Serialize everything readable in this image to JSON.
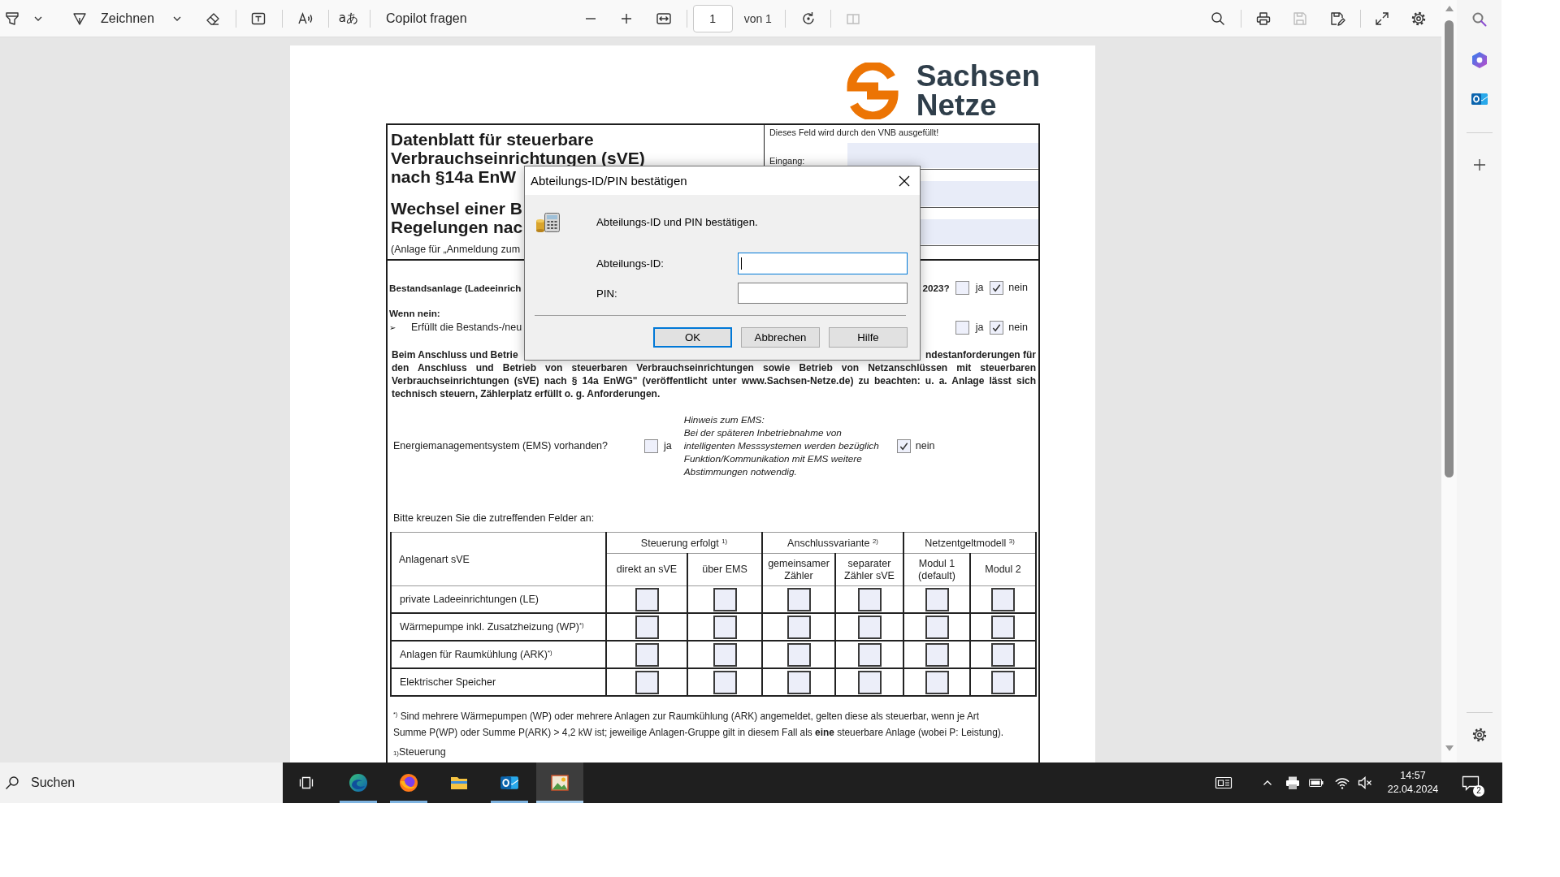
{
  "toolbar": {
    "draw_label": "Zeichnen",
    "translate_label": "aあ",
    "copilot_label": "Copilot fragen",
    "page_number": "1",
    "page_total": "von 1",
    "two_page_disabled": true,
    "save_disabled": true
  },
  "document": {
    "logo": {
      "line_1": "Sachsen",
      "line_2": "Netze"
    },
    "title_lines": [
      "Datenblatt für steuerbare",
      "Verbrauchseinrichtungen (sVE)",
      "nach §14a EnW"
    ],
    "subtitle_lines": [
      "Wechsel einer B",
      "Regelungen nac"
    ],
    "annex_note": "(Anlage für „Anmeldung zum",
    "office_note": "Dieses Feld wird durch den VNB ausgefüllt!",
    "office_field_label": "Eingang:",
    "existing_question": {
      "text": "Bestandsanlage (Ladeeinrich",
      "tail": "2023?",
      "options": [
        {
          "label": "ja",
          "checked": false
        },
        {
          "label": "nein",
          "checked": true
        }
      ]
    },
    "if_no": {
      "heading": "Wenn nein:",
      "bullet": "➢",
      "text": "Erfüllt die Bestands-/neu",
      "options": [
        {
          "label": "ja",
          "checked": false
        },
        {
          "label": "nein",
          "checked": true
        }
      ]
    },
    "notice": {
      "start": "Beim Anschluss und Betrie",
      "end": "ndestanforderungen für",
      "text": "den Anschluss und Betrieb von steuerbaren Verbrauchseinrichtungen sowie Betrieb von Netzanschlüssen mit steuerbaren Verbrauchseinrichtungen (sVE) nach § 14a EnWG\" (veröffentlicht unter www.Sachsen-Netze.de) zu beachten: u. a. Anlage lässt sich technisch steuern, Zählerplatz erfüllt o. g. Anforderungen."
    },
    "ems": {
      "question": "Energiemanagementsystem (EMS) vorhanden?",
      "options": [
        {
          "label": "ja",
          "checked": false
        },
        {
          "label": "nein",
          "checked": true
        }
      ],
      "hint_title": "Hinweis zum EMS:",
      "hint": "Bei der späteren Inbetriebnahme von intelligenten Messsystemen werden bezüglich Funktion/Kommunikation mit EMS weitere Abstimmungen notwendig."
    },
    "instruction": "Bitte kreuzen Sie die zutreffenden Felder an:",
    "table": {
      "row_header": "Anlagenart sVE",
      "groups": [
        {
          "label": "Steuerung erfolgt $^{1)}$",
          "columns": [
            "direkt an sVE",
            "über EMS"
          ]
        },
        {
          "label": "Anschlussvariante $^{2)}$",
          "columns": [
            "gemeinsamer Zähler",
            "separater Zähler sVE"
          ]
        },
        {
          "label": "Netzentgeltmodell $^{3)}$",
          "columns": [
            "Modul 1 (default)",
            "Modul 2"
          ]
        }
      ],
      "rows": [
        {
          "label": "private Ladeeinrichtungen (LE)",
          "checks": [
            false,
            false,
            false,
            false,
            false,
            false
          ]
        },
        {
          "label": "Wärmepumpe inkl. Zusatzheizung (WP)$^{*)}$",
          "checks": [
            false,
            false,
            false,
            false,
            false,
            false
          ]
        },
        {
          "label": "Anlagen für Raumkühlung (ARK)$^{*)}$",
          "checks": [
            false,
            false,
            false,
            false,
            false,
            false
          ]
        },
        {
          "label": "Elektrischer Speicher",
          "checks": [
            false,
            false,
            false,
            false,
            false,
            false
          ]
        }
      ]
    },
    "footnote": "$^{*)}$ Sind mehrere Wärmepumpen (WP) oder mehrere Anlagen zur Raumkühlung (ARK) angemeldet, gelten diese als steuerbar, wenn je Art Summe P(WP) oder Summe P(ARK) > 4,2 kW ist; jeweilige Anlagen-Gruppe gilt in diesem Fall als **eine** steuerbare Anlage (wobei P: Leistung).",
    "footnote_2": "$_{1)}$Steuerung"
  },
  "dialog": {
    "title": "Abteilungs-ID/PIN bestätigen",
    "message": "Abteilungs-ID und PIN bestätigen.",
    "fields": [
      {
        "label": "Abteilungs-ID:",
        "focused": true
      },
      {
        "label": "PIN:",
        "focused": false
      }
    ],
    "buttons": [
      {
        "label": "OK",
        "default": true
      },
      {
        "label": "Abbrechen",
        "default": false
      },
      {
        "label": "Hilfe",
        "default": false
      }
    ]
  },
  "taskbar": {
    "search_placeholder": "Suchen",
    "apps": [
      {
        "running": true,
        "selected": false
      },
      {
        "running": true,
        "selected": false
      },
      {
        "running": false,
        "selected": false
      },
      {
        "running": true,
        "selected": false
      },
      {
        "running": true,
        "selected": true
      }
    ],
    "time": "14:57",
    "date": "22.04.2024",
    "notification_count": "2"
  }
}
